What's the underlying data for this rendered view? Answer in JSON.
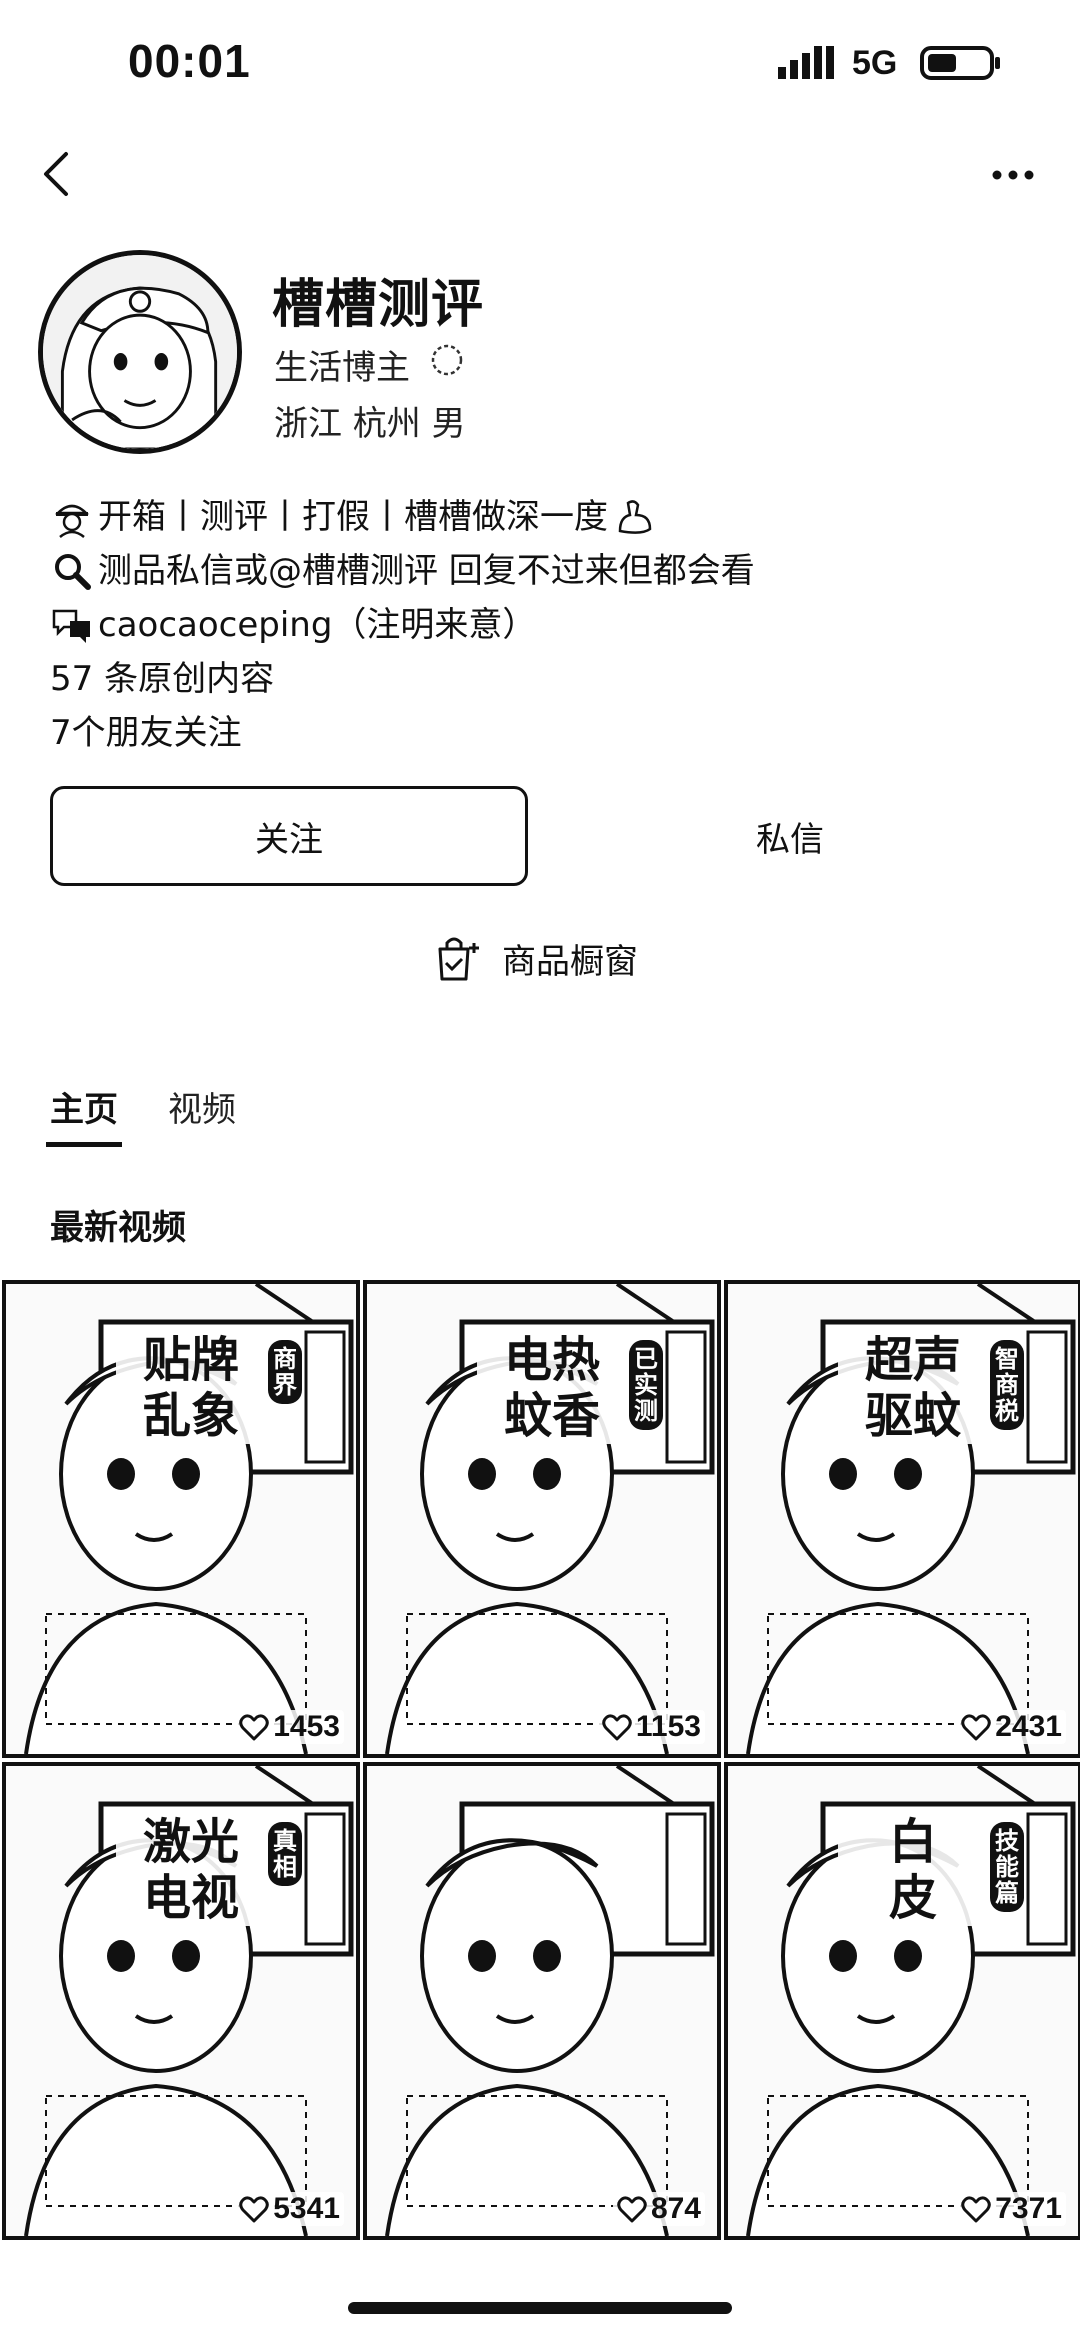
{
  "status_bar": {
    "time": "00:01",
    "network": "5G"
  },
  "profile": {
    "name": "槽槽测评",
    "role": "生活博主",
    "location": "浙江 杭州 男"
  },
  "bio": {
    "line1": "开箱丨测评丨打假丨槽槽做深一度",
    "line2": "测品私信或@槽槽测评 回复不过来但都会看",
    "line3": "caocaoceping（注明来意）",
    "line4": "57 条原创内容",
    "line5": "7个朋友关注"
  },
  "actions": {
    "follow": "关注",
    "message": "私信",
    "shop_window": "商品橱窗"
  },
  "tabs": [
    {
      "label": "主页",
      "active": true
    },
    {
      "label": "视频",
      "active": false
    }
  ],
  "section": {
    "title": "最新视频"
  },
  "videos": [
    {
      "title_a": "贴牌",
      "title_b": "乱象",
      "tag": "商界",
      "likes": "1453"
    },
    {
      "title_a": "电热",
      "title_b": "蚊香",
      "tag": "已实测",
      "likes": "1153"
    },
    {
      "title_a": "超声",
      "title_b": "驱蚊",
      "tag": "智商税",
      "likes": "2431"
    },
    {
      "title_a": "激光",
      "title_b": "电视",
      "tag": "真相",
      "likes": "5341"
    },
    {
      "title_a": "",
      "title_b": "",
      "tag": "",
      "likes": "874"
    },
    {
      "title_a": "白",
      "title_b": "皮",
      "tag": "技能篇",
      "likes": "7371"
    }
  ],
  "colors": {
    "ink": "#111111",
    "background": "#ffffff"
  },
  "icons": {
    "back": "chevron-left-icon",
    "more": "ellipsis-icon",
    "shop": "shopping-bag-icon",
    "like": "heart-icon"
  }
}
